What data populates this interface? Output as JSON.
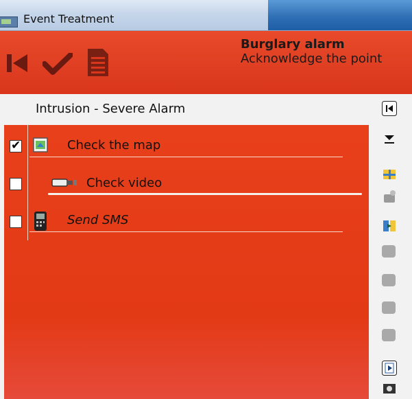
{
  "window": {
    "title": "Event Treatment"
  },
  "header": {
    "title": "Burglary alarm",
    "subtitle": "Acknowledge the point"
  },
  "section": {
    "title": "Intrusion - Severe Alarm"
  },
  "tasks": [
    {
      "label": "Check the map",
      "checked": true,
      "icon": "map-icon"
    },
    {
      "label": "Check video",
      "checked": false,
      "icon": "camera-icon"
    },
    {
      "label": "Send SMS",
      "checked": false,
      "icon": "phone-icon"
    }
  ],
  "colors": {
    "header_red": "#e1411f",
    "panel_red": "#e53c17",
    "title_bar": "#c9d9ec"
  },
  "rail_icons": [
    "first-icon",
    "dropdown-arrow-icon",
    "grid-icon",
    "disabled-action-icon",
    "swap-icon",
    "empty-slot-icon",
    "empty-slot-icon",
    "empty-slot-icon",
    "empty-slot-icon",
    "play-document-icon",
    "camera-small-icon"
  ]
}
